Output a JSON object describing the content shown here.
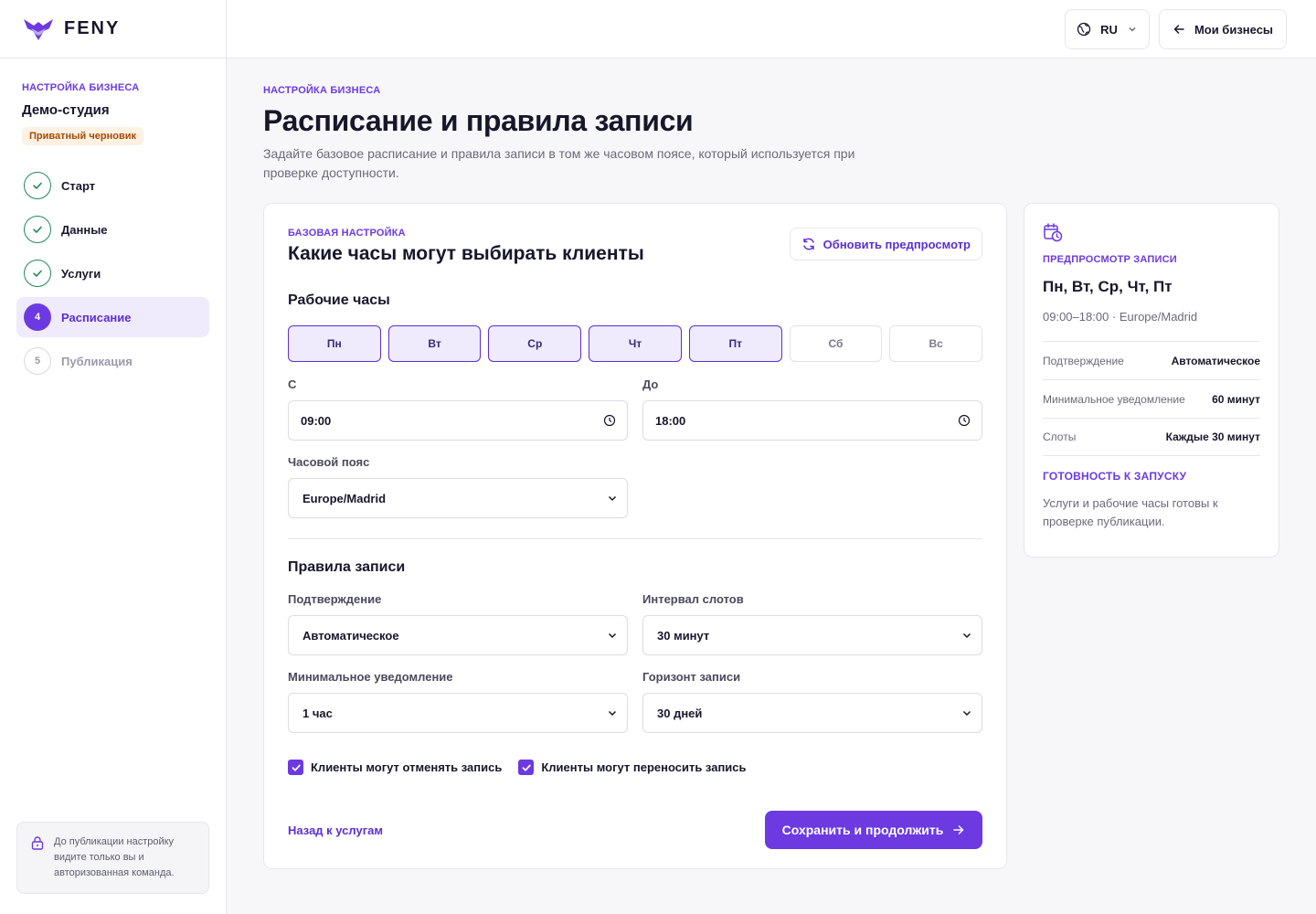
{
  "app": {
    "logo_text": "FENY"
  },
  "sidebar": {
    "eyebrow": "НАСТРОЙКА БИЗНЕСА",
    "business_name": "Демо-студия",
    "status_badge": "Приватный черновик",
    "steps": [
      {
        "label": "Старт",
        "state": "done"
      },
      {
        "label": "Данные",
        "state": "done"
      },
      {
        "label": "Услуги",
        "state": "done"
      },
      {
        "label": "Расписание",
        "number": "4",
        "state": "active"
      },
      {
        "label": "Публикация",
        "number": "5",
        "state": "pending"
      }
    ],
    "privacy_note": "До публикации настройку видите только вы и авторизованная команда."
  },
  "topbar": {
    "language": "RU",
    "my_businesses": "Мои бизнесы"
  },
  "page": {
    "eyebrow": "НАСТРОЙКА БИЗНЕСА",
    "title": "Расписание и правила записи",
    "description": "Задайте базовое расписание и правила записи в том же часовом поясе, который используется при проверке доступности."
  },
  "card": {
    "eyebrow": "БАЗОВАЯ НАСТРОЙКА",
    "title": "Какие часы могут выбирать клиенты",
    "refresh_button": "Обновить предпросмотр",
    "working_hours": {
      "title": "Рабочие часы",
      "days": [
        {
          "label": "Пн",
          "selected": true
        },
        {
          "label": "Вт",
          "selected": true
        },
        {
          "label": "Ср",
          "selected": true
        },
        {
          "label": "Чт",
          "selected": true
        },
        {
          "label": "Пт",
          "selected": true
        },
        {
          "label": "Сб",
          "selected": false
        },
        {
          "label": "Вс",
          "selected": false
        }
      ],
      "from_label": "С",
      "from_value": "09:00",
      "to_label": "До",
      "to_value": "18:00",
      "timezone_label": "Часовой пояс",
      "timezone_value": "Europe/Madrid"
    },
    "booking_rules": {
      "title": "Правила записи",
      "confirmation_label": "Подтверждение",
      "confirmation_value": "Автоматическое",
      "slot_interval_label": "Интервал слотов",
      "slot_interval_value": "30 минут",
      "min_notice_label": "Минимальное уведомление",
      "min_notice_value": "1 час",
      "horizon_label": "Горизонт записи",
      "horizon_value": "30 дней",
      "can_cancel_label": "Клиенты могут отменять запись",
      "can_cancel_checked": true,
      "can_reschedule_label": "Клиенты могут переносить запись",
      "can_reschedule_checked": true
    },
    "back_link": "Назад к услугам",
    "save_button": "Сохранить и продолжить"
  },
  "preview": {
    "eyebrow": "ПРЕДПРОСМОТР ЗАПИСИ",
    "days": "Пн, Вт, Ср, Чт, Пт",
    "hours": "09:00–18:00 · Europe/Madrid",
    "rows": [
      {
        "key": "Подтверждение",
        "value": "Автоматическое"
      },
      {
        "key": "Минимальное уведомление",
        "value": "60 минут"
      },
      {
        "key": "Слоты",
        "value": "Каждые 30 минут"
      }
    ],
    "ready_eyebrow": "ГОТОВНОСТЬ К ЗАПУСКУ",
    "ready_text": "Услуги и рабочие часы готовы к проверке публикации."
  },
  "colors": {
    "accent": "#6c3ae0",
    "success": "#1f8a55",
    "badge_bg": "#fdf1e4",
    "badge_text": "#a64a00"
  },
  "icons": [
    "feny-logo-icon",
    "globe-icon",
    "chevron-down-icon",
    "arrow-left-icon",
    "check-icon",
    "lock-icon",
    "refresh-icon",
    "clock-icon",
    "calendar-clock-icon",
    "arrow-right-icon"
  ]
}
